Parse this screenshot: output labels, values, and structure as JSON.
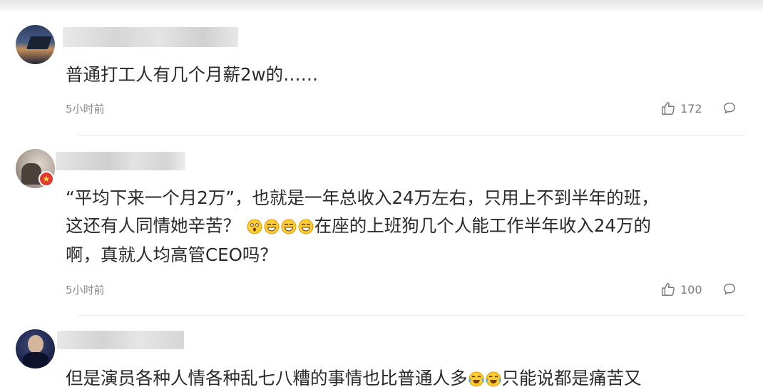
{
  "comments": [
    {
      "lines": [
        "普通打工人有几个月薪2w的……"
      ],
      "time": "5小时前",
      "likes": "172"
    },
    {
      "lines": [
        "“平均下来一个月2万”，也就是一年总收入24万左右，只用上不到半年的班，",
        "这还有人同情她辛苦？",
        "在座的上班狗几个人能工作半年收入24万的",
        "啊，真就人均高管CEO吗？"
      ],
      "time": "5小时前",
      "likes": "100"
    },
    {
      "lines": [
        "但是演员各种人情各种乱七八糟的事情也比普通人多",
        "只能说都是痛苦又"
      ]
    }
  ],
  "icons": {
    "like": "thumbs-up-icon",
    "reply": "comment-bubble-icon",
    "emoji": [
      "shocked-emoji",
      "grin-emoji",
      "grin-emoji",
      "grin-emoji",
      "crying-laugh-emoji"
    ]
  },
  "colors": {
    "text": "#2a2a2a",
    "meta": "#8a8a8a",
    "badge": "#e23a2e"
  }
}
